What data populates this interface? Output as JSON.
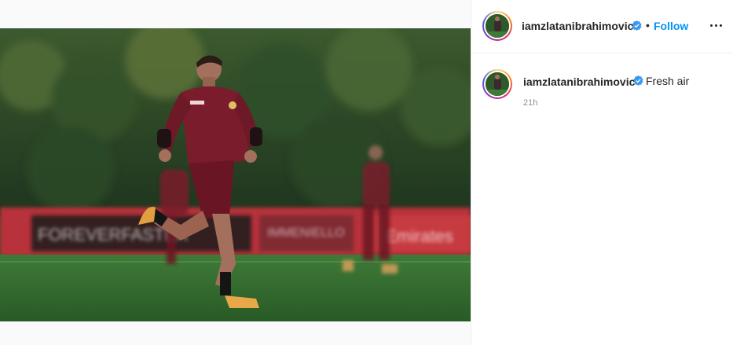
{
  "post": {
    "username": "iamzlatanibrahimovic",
    "follow_label": "Follow",
    "separator": "•",
    "caption": "Fresh air",
    "timestamp": "21h",
    "ad_boards": [
      "FOREVERFASTER",
      "IMMENIELLO",
      "Emirates"
    ]
  },
  "colors": {
    "follow_blue": "#0095f6",
    "verified_blue": "#3897f0",
    "muted_text": "#8e8e8e",
    "jersey": "#7a1c2c"
  },
  "icons": {
    "verified": "verified-badge-icon",
    "more": "more-options-icon"
  }
}
